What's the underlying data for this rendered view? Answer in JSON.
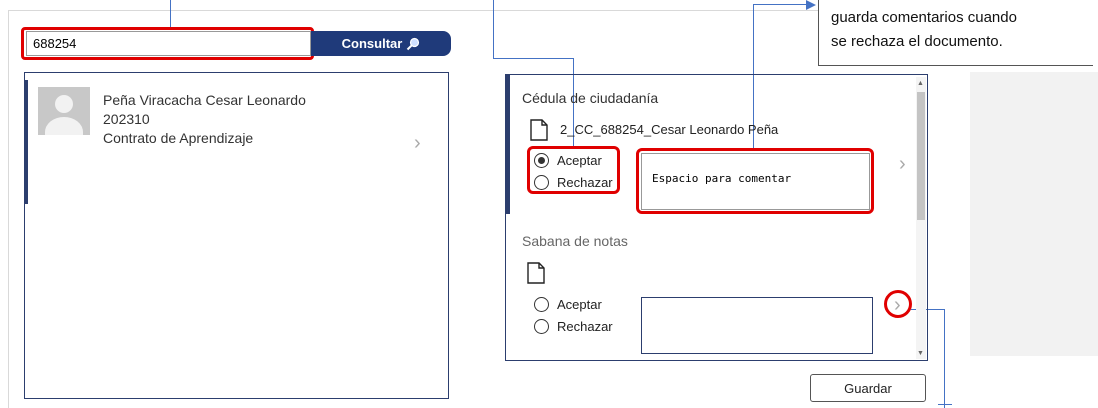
{
  "search": {
    "value": "688254",
    "button_label": "Consultar"
  },
  "left_card": {
    "name": "Peña Viracacha Cesar Leonardo",
    "code": "202310",
    "contract": "Contrato de Aprendizaje"
  },
  "documents": [
    {
      "title": "Cédula de ciudadanía",
      "file_name": "2_CC_688254_Cesar Leonardo Peña",
      "accept_label": "Aceptar",
      "reject_label": "Rechazar",
      "selected": "Aceptar",
      "comment": "Espacio para comentar"
    },
    {
      "title": "Sabana de notas",
      "file_name": "",
      "accept_label": "Aceptar",
      "reject_label": "Rechazar",
      "selected": "",
      "comment": ""
    }
  ],
  "save_label": "Guardar",
  "callout": {
    "line1": "guarda comentarios cuando",
    "line2": "se rechaza el documento."
  },
  "colors": {
    "accent": "#1f3a7a",
    "highlight": "#e00000",
    "connector": "#4472c4"
  }
}
